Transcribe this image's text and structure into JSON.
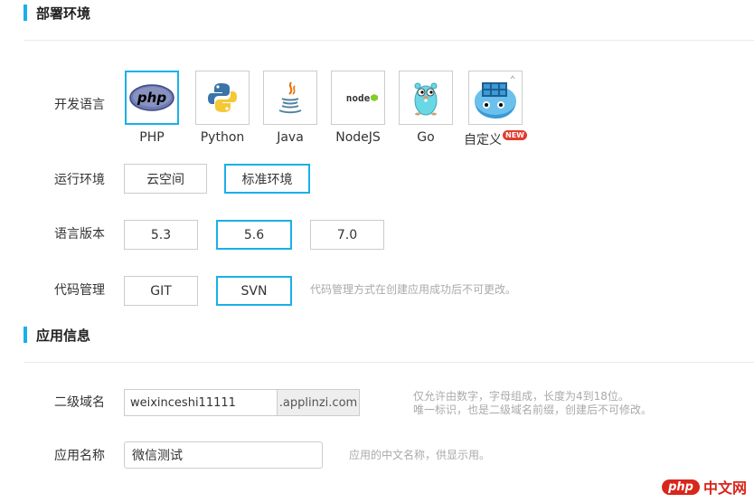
{
  "deploy_section": {
    "title": "部署环境"
  },
  "dev_language": {
    "label": "开发语言",
    "options": [
      {
        "name": "PHP",
        "icon": "php-icon",
        "selected": true
      },
      {
        "name": "Python",
        "icon": "python-icon",
        "selected": false
      },
      {
        "name": "Java",
        "icon": "java-icon",
        "selected": false
      },
      {
        "name": "NodeJS",
        "icon": "nodejs-icon",
        "selected": false
      },
      {
        "name": "Go",
        "icon": "go-gopher-icon",
        "selected": false
      },
      {
        "name": "自定义",
        "icon": "docker-whale-icon",
        "selected": false,
        "badge": "NEW"
      }
    ]
  },
  "runtime": {
    "label": "运行环境",
    "options": [
      {
        "name": "云空间",
        "selected": false
      },
      {
        "name": "标准环境",
        "selected": true
      }
    ]
  },
  "lang_version": {
    "label": "语言版本",
    "options": [
      {
        "name": "5.3",
        "selected": false
      },
      {
        "name": "5.6",
        "selected": true
      },
      {
        "name": "7.0",
        "selected": false
      }
    ]
  },
  "vcs": {
    "label": "代码管理",
    "options": [
      {
        "name": "GIT",
        "selected": false
      },
      {
        "name": "SVN",
        "selected": true
      }
    ],
    "hint": "代码管理方式在创建应用成功后不可更改。"
  },
  "app_section": {
    "title": "应用信息"
  },
  "subdomain": {
    "label": "二级域名",
    "value": "weixinceshi11111",
    "suffix": ".applinzi.com",
    "hint_line1": "仅允许由数字，字母组成，长度为4到18位。",
    "hint_line2": "唯一标识，也是二级域名前缀，创建后不可修改。"
  },
  "app_name": {
    "label": "应用名称",
    "value": "微信测试",
    "hint": "应用的中文名称，供显示用。"
  },
  "watermark": {
    "logo": "php",
    "site": "中文网"
  },
  "colors": {
    "accent": "#1ab0e8",
    "border": "#cccccc",
    "hint": "#aaaaaa",
    "badge": "#e23b2e"
  }
}
